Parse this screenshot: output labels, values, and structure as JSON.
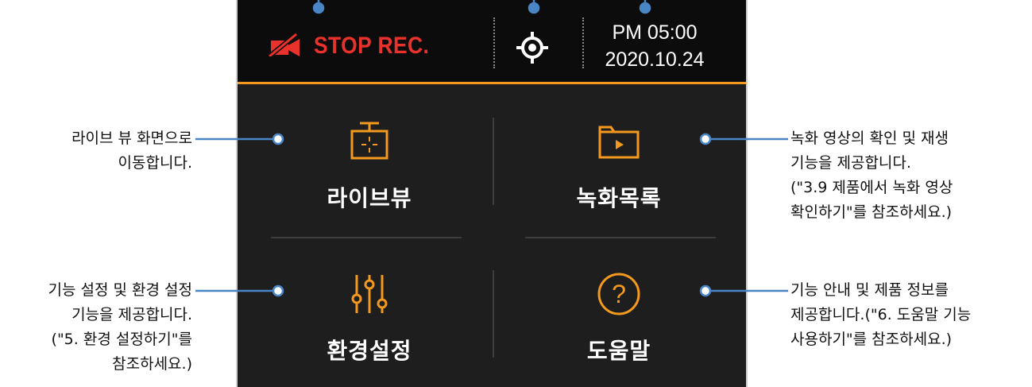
{
  "status_bar": {
    "rec_label": "STOP REC.",
    "time": "PM 05:00",
    "date": "2020.10.24",
    "rec_icon": "camera-off-icon",
    "gps_icon": "gps-target-icon"
  },
  "menu": {
    "live_view": {
      "label": "라이브뷰",
      "icon": "live-view-icon"
    },
    "recordings": {
      "label": "녹화목록",
      "icon": "folder-play-icon"
    },
    "settings": {
      "label": "환경설정",
      "icon": "sliders-icon"
    },
    "help": {
      "label": "도움말",
      "icon": "question-circle-icon"
    }
  },
  "callouts": {
    "live_view": [
      "라이브 뷰 화면으로",
      "이동합니다."
    ],
    "settings": [
      "기능 설정 및 환경 설정",
      "기능을 제공합니다.",
      "(\"5. 환경 설정하기\"를",
      "참조하세요.)"
    ],
    "recordings": [
      "녹화 영상의 확인 및 재생",
      "기능을 제공합니다.",
      "(\"3.9 제품에서 녹화 영상",
      "확인하기\"를 참조하세요.)"
    ],
    "help": [
      "기능 안내 및 제품 정보를",
      "제공합니다.(\"6. 도움말 기능",
      "사용하기\"를 참조하세요.)"
    ]
  },
  "colors": {
    "accent_orange": "#f39a1e",
    "rec_red": "#e8322b",
    "callout_blue": "#4a86c5",
    "screen_bg": "#1e1e1e"
  }
}
